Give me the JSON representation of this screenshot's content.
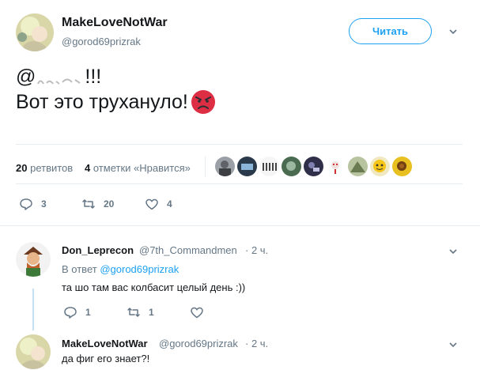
{
  "tweet": {
    "author_name": "MakeLoveNotWar",
    "author_handle": "@gorod69prizrak",
    "follow_label": "Читать",
    "text_line1": "@",
    "text_line1_rest": "!!!",
    "text_line2": "Вот это трухануло!",
    "emoji": "angry-face"
  },
  "stats": {
    "retweets_count": "20",
    "retweets_label": "ретвитов",
    "likes_count": "4",
    "likes_label": "отметки «Нравится»",
    "liker_avatars": 10
  },
  "actions": {
    "reply_count": "3",
    "retweet_count": "20",
    "like_count": "4"
  },
  "replies": [
    {
      "name": "Don_Leprecon",
      "handle": "@7th_Commandmen",
      "time": "· 2 ч.",
      "in_reply_prefix": "В ответ",
      "in_reply_to": "@gorod69prizrak",
      "text": "та шо там вас колбасит целый день :))",
      "reply_count": "1",
      "retweet_count": "1",
      "like_count": ""
    },
    {
      "name": "MakeLoveNotWar",
      "handle": "@gorod69prizrak",
      "time": "· 2 ч.",
      "text": "да фиг его знает?!"
    }
  ],
  "colors": {
    "accent": "#1da1f2",
    "muted": "#657786",
    "text": "#14171a",
    "divider": "#e6ecf0"
  }
}
